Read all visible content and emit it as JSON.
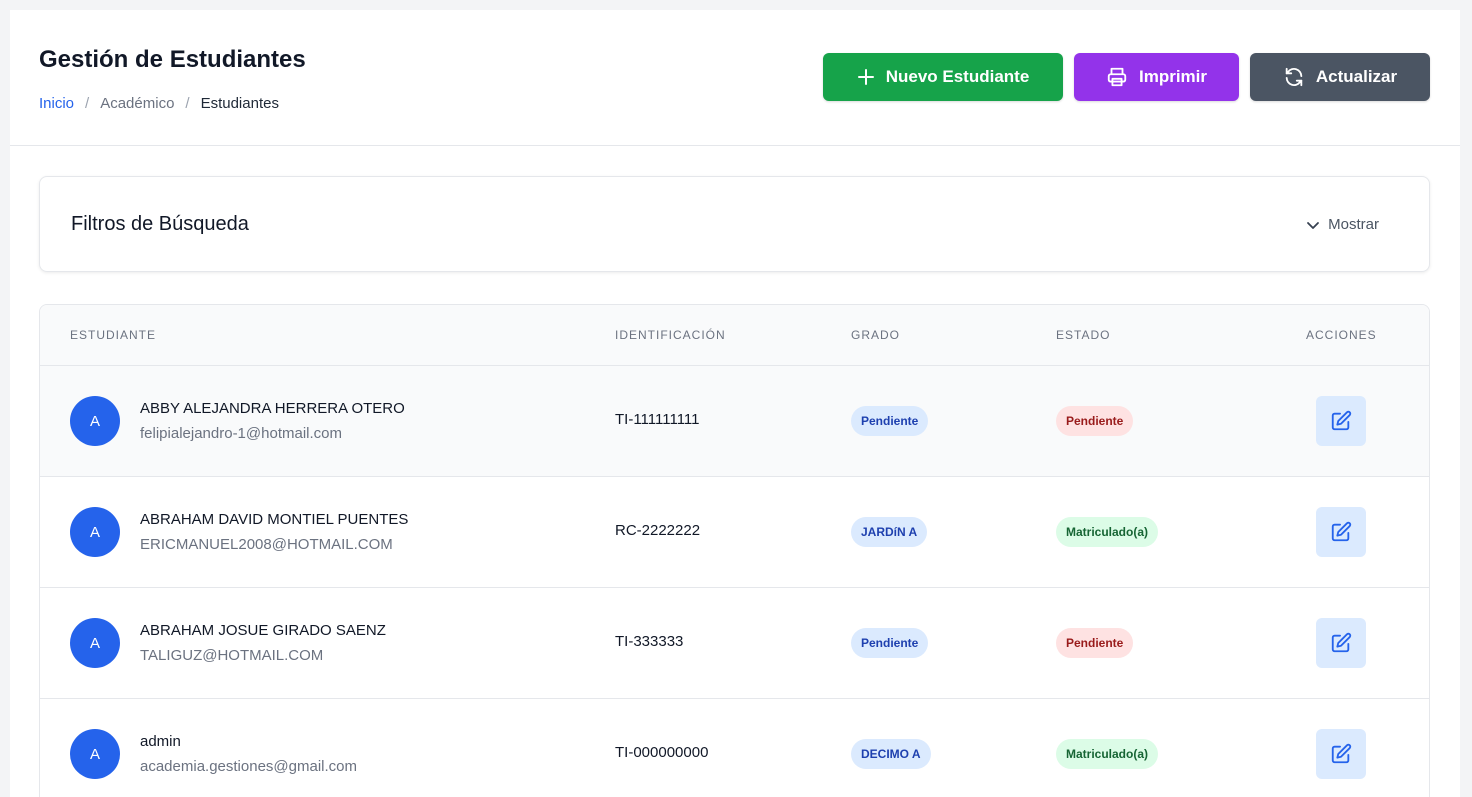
{
  "header": {
    "title": "Gestión de Estudiantes",
    "breadcrumb": [
      "Inicio",
      "Académico",
      "Estudiantes"
    ],
    "separator": "/"
  },
  "actions": {
    "new_label": "Nuevo Estudiante",
    "print_label": "Imprimir",
    "refresh_label": "Actualizar",
    "colors": {
      "new": "#16a34a",
      "print": "#9333ea",
      "refresh": "#4b5563"
    }
  },
  "filters": {
    "title": "Filtros de Búsqueda",
    "toggle_label": "Mostrar",
    "toggle_icon": "chevron-down-icon"
  },
  "table": {
    "columns": [
      "ESTUDIANTE",
      "IDENTIFICACIÓN",
      "GRADO",
      "ESTADO",
      "ACCIONES"
    ],
    "rows": [
      {
        "initial": "A",
        "name": "ABBY ALEJANDRA HERRERA OTERO",
        "email": "felipialejandro-1@hotmail.com",
        "id": "TI-111111111",
        "grade": "Pendiente",
        "status": "Pendiente"
      },
      {
        "initial": "A",
        "name": "ABRAHAM DAVID MONTIEL PUENTES",
        "email": "ERICMANUEL2008@HOTMAIL.COM",
        "id": "RC-2222222",
        "grade": "JARDíN A",
        "status": "Matriculado(a)"
      },
      {
        "initial": "A",
        "name": "ABRAHAM JOSUE GIRADO SAENZ",
        "email": "TALIGUZ@HOTMAIL.COM",
        "id": "TI-333333",
        "grade": "Pendiente",
        "status": "Pendiente"
      },
      {
        "initial": "A",
        "name": "admin",
        "email": "academia.gestiones@gmail.com",
        "id": "TI-000000000",
        "grade": "DECIMO A",
        "status": "Matriculado(a)"
      }
    ]
  },
  "colors": {
    "accent": "#2563eb",
    "badge_grade_bg": "#dbeafe",
    "badge_pending_bg": "#fee2e2",
    "badge_enrolled_bg": "#dcfce7"
  }
}
